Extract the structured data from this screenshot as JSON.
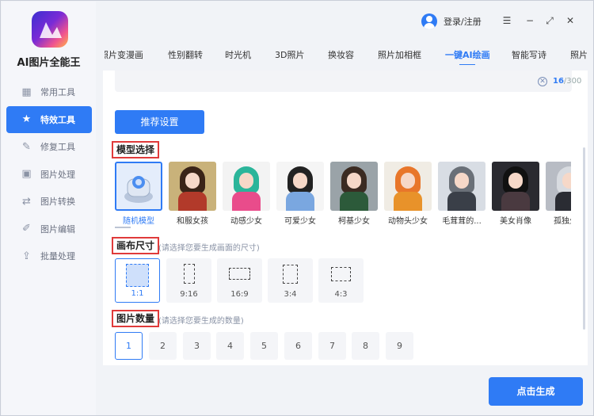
{
  "app": {
    "title": "AI图片全能王"
  },
  "sidebar": {
    "items": [
      {
        "label": "常用工具",
        "icon": "grid-icon"
      },
      {
        "label": "特效工具",
        "icon": "star-icon",
        "active": true
      },
      {
        "label": "修复工具",
        "icon": "magic-wand-icon"
      },
      {
        "label": "图片处理",
        "icon": "image-icon"
      },
      {
        "label": "图片转换",
        "icon": "convert-icon"
      },
      {
        "label": "图片编辑",
        "icon": "edit-icon"
      },
      {
        "label": "批量处理",
        "icon": "batch-upload-icon"
      }
    ]
  },
  "header": {
    "login_label": "登录/注册",
    "menu_icon": "☰",
    "minimize_icon": "−",
    "maximize_icon": "⤢",
    "close_icon": "✕"
  },
  "tabs": [
    {
      "label": "照片变漫画"
    },
    {
      "label": "性别翻转"
    },
    {
      "label": "时光机"
    },
    {
      "label": "3D照片"
    },
    {
      "label": "换妆容"
    },
    {
      "label": "照片加相框"
    },
    {
      "label": "一键AI绘画",
      "active": true
    },
    {
      "label": "智能写诗"
    },
    {
      "label": "照片"
    }
  ],
  "prompt": {
    "clear_icon": "✕",
    "count": "16",
    "max": "/300"
  },
  "recommend_button": "推荐设置",
  "model_section": {
    "title": "模型选择",
    "models": [
      {
        "name": "随机模型",
        "active": true
      },
      {
        "name": "和服女孩"
      },
      {
        "name": "动感少女"
      },
      {
        "name": "可爱少女"
      },
      {
        "name": "柯基少女"
      },
      {
        "name": "动物头少女"
      },
      {
        "name": "毛茸茸的..."
      },
      {
        "name": "美女肖像"
      },
      {
        "name": "孤独少女"
      }
    ]
  },
  "canvas_section": {
    "title": "画布尺寸",
    "hint": "(请选择您要生成画面的尺寸)",
    "options": [
      {
        "label": "1:1",
        "active": true
      },
      {
        "label": "9:16"
      },
      {
        "label": "16:9"
      },
      {
        "label": "3:4"
      },
      {
        "label": "4:3"
      }
    ]
  },
  "count_section": {
    "title": "图片数量",
    "hint": "(请选择您要生成的数量)",
    "options": [
      "1",
      "2",
      "3",
      "4",
      "5",
      "6",
      "7",
      "8",
      "9"
    ],
    "selected": "1"
  },
  "generate_button": "点击生成",
  "colors": {
    "accent": "#2f7bf5",
    "highlight_border": "#e03a3a"
  }
}
